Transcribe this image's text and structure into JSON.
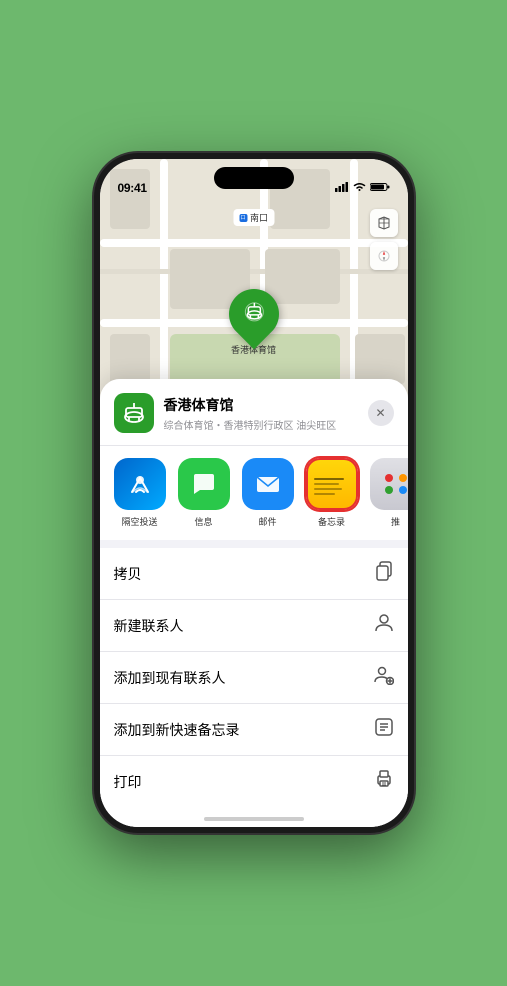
{
  "status": {
    "time": "09:41",
    "location_arrow": "▶",
    "signal_bars": "▋▋▋",
    "wifi": "wifi",
    "battery": "battery"
  },
  "map": {
    "label": "南口",
    "map_icon": "🗺",
    "location_icon": "➤"
  },
  "venue": {
    "name": "香港体育馆",
    "description": "综合体育馆・香港特别行政区 油尖旺区",
    "icon": "🏟",
    "pin_emoji": "🏟"
  },
  "share_items": [
    {
      "id": "airdrop",
      "label": "隔空投送",
      "type": "airdrop"
    },
    {
      "id": "messages",
      "label": "信息",
      "type": "messages"
    },
    {
      "id": "mail",
      "label": "邮件",
      "type": "mail"
    },
    {
      "id": "notes",
      "label": "备忘录",
      "type": "notes"
    },
    {
      "id": "more",
      "label": "推",
      "type": "more-icon"
    }
  ],
  "menu_items": [
    {
      "id": "copy",
      "label": "拷贝",
      "icon": "📋"
    },
    {
      "id": "new-contact",
      "label": "新建联系人",
      "icon": "👤"
    },
    {
      "id": "add-existing",
      "label": "添加到现有联系人",
      "icon": "👤+"
    },
    {
      "id": "add-notes",
      "label": "添加到新快速备忘录",
      "icon": "📝"
    },
    {
      "id": "print",
      "label": "打印",
      "icon": "🖨"
    }
  ]
}
